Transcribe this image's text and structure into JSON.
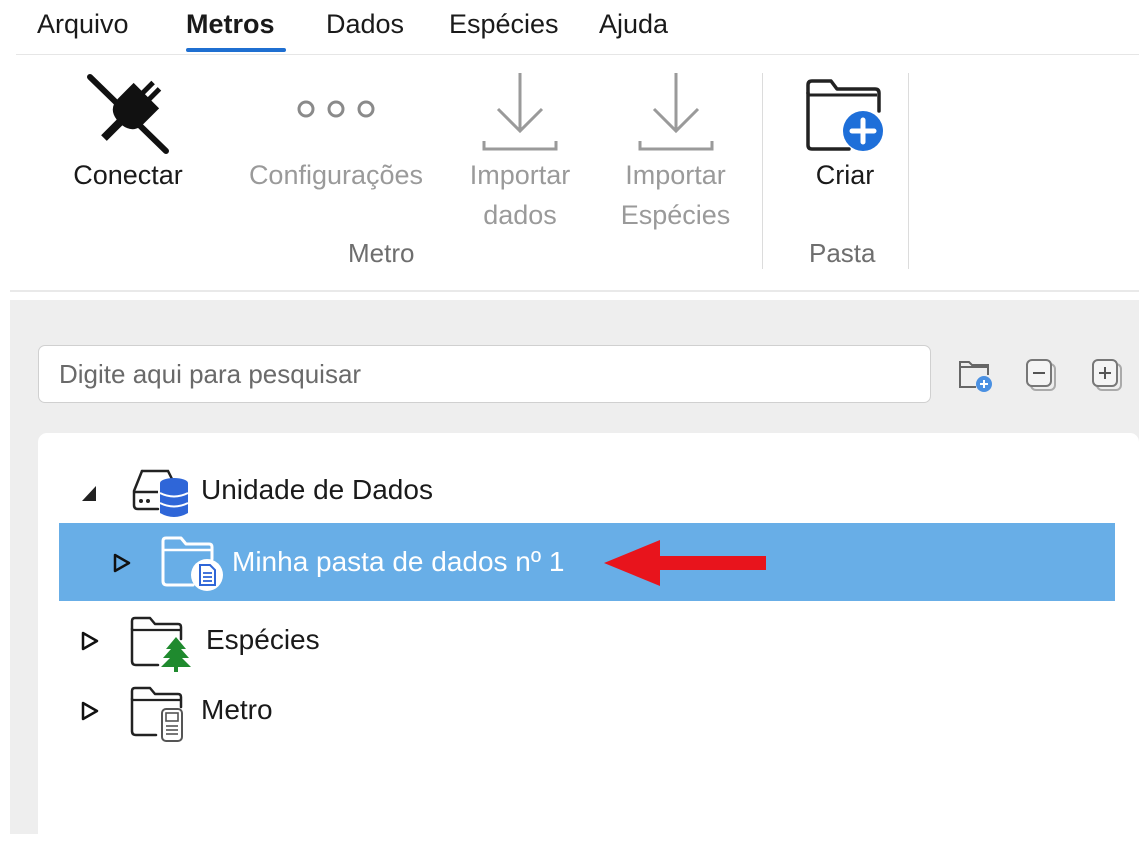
{
  "menu": {
    "items": [
      {
        "label": "Arquivo",
        "active": false
      },
      {
        "label": "Metros",
        "active": true
      },
      {
        "label": "Dados",
        "active": false
      },
      {
        "label": "Espécies",
        "active": false
      },
      {
        "label": "Ajuda",
        "active": false
      }
    ]
  },
  "ribbon": {
    "connect": {
      "label": "Conectar",
      "icon": "plug-disconnected-icon",
      "enabled": true
    },
    "settings": {
      "label": "Configurações",
      "icon": "more-options-icon",
      "enabled": false
    },
    "import_data": {
      "line1": "Importar",
      "line2": "dados",
      "icon": "download-icon",
      "enabled": false
    },
    "import_species": {
      "line1": "Importar",
      "line2": "Espécies",
      "icon": "download-icon",
      "enabled": false
    },
    "create": {
      "label": "Criar",
      "icon": "new-folder-icon",
      "enabled": true
    },
    "group_meter": "Metro",
    "group_folder": "Pasta"
  },
  "search": {
    "placeholder": "Digite aqui para pesquisar",
    "value": ""
  },
  "tree": {
    "root": {
      "label": "Unidade de Dados",
      "expanded": true,
      "icon": "database-drive-icon"
    },
    "items": [
      {
        "label": "Minha pasta de dados nº 1",
        "selected": true,
        "expanded": false,
        "icon": "data-folder-icon"
      },
      {
        "label": "Espécies",
        "selected": false,
        "expanded": false,
        "icon": "species-folder-icon"
      },
      {
        "label": "Metro",
        "selected": false,
        "expanded": false,
        "icon": "meter-folder-icon"
      }
    ]
  },
  "colors": {
    "accent": "#1f6fd1",
    "selection": "#68aee7",
    "annotation_arrow": "#e8141c",
    "tree_green": "#1f8a2e",
    "db_blue": "#2f66d8"
  }
}
